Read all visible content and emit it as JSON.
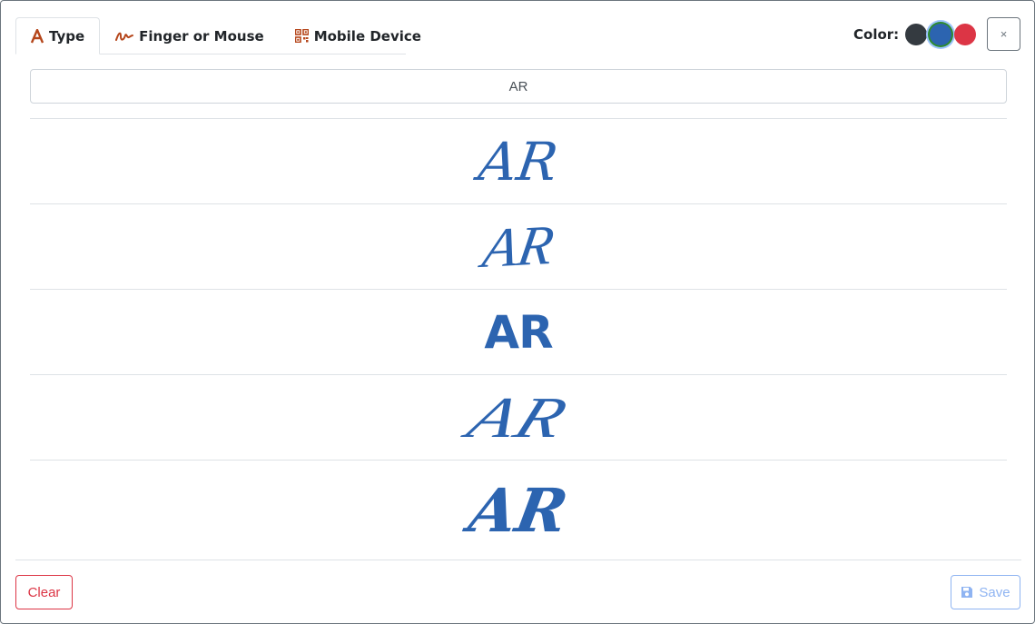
{
  "tabs": [
    {
      "label": "Type",
      "icon": "type-letter-icon",
      "active": true
    },
    {
      "label": "Finger or Mouse",
      "icon": "signature-squiggle-icon",
      "active": false
    },
    {
      "label": "Mobile Device",
      "icon": "qr-code-icon",
      "active": false
    }
  ],
  "color_picker": {
    "label": "Color:",
    "swatches": [
      {
        "name": "black",
        "hex": "#343a40",
        "selected": false
      },
      {
        "name": "blue",
        "hex": "#2c64b0",
        "selected": true
      },
      {
        "name": "red",
        "hex": "#dc3545",
        "selected": false
      }
    ]
  },
  "close_label": "×",
  "signature_input": {
    "value": "AR"
  },
  "signature_options": [
    "AR",
    "AR",
    "AR",
    "AR",
    "AR"
  ],
  "footer": {
    "clear_label": "Clear",
    "save_label": "Save"
  },
  "colors": {
    "accent": "#2c64b0",
    "danger": "#dc3545",
    "icon": "#b5461b"
  }
}
